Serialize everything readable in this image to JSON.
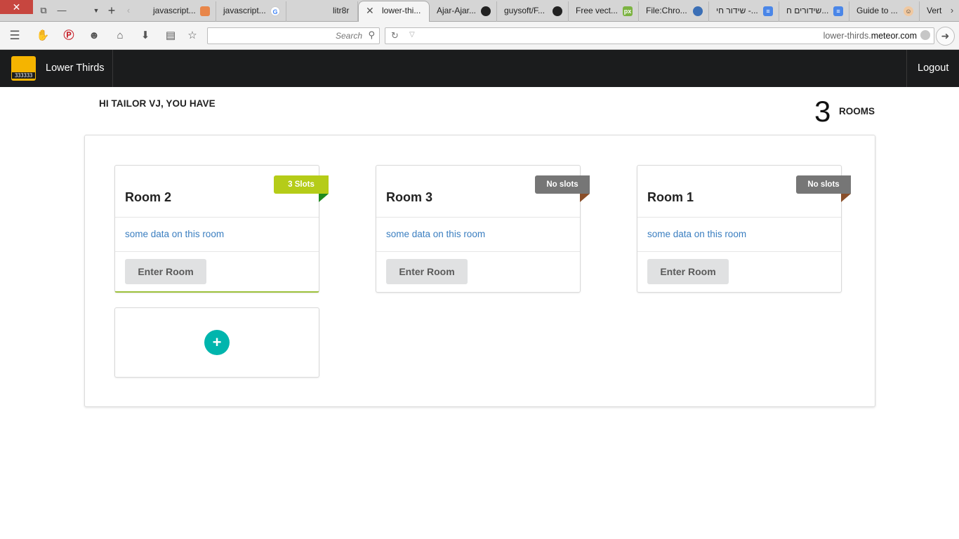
{
  "browser": {
    "tabs": [
      {
        "label": "javascript..."
      },
      {
        "label": "javascript..."
      },
      {
        "label": "litr8r"
      },
      {
        "label": "lower-thi..."
      },
      {
        "label": "Ajar-Ajar..."
      },
      {
        "label": "guysoft/F..."
      },
      {
        "label": "Free vect..."
      },
      {
        "label": "File:Chro..."
      },
      {
        "label": "שידור חי -..."
      },
      {
        "label": "שידורים ח..."
      },
      {
        "label": "Guide to ..."
      },
      {
        "label": "Vert"
      }
    ],
    "search_placeholder": "Search",
    "url_prefix": "lower-thirds.",
    "url_domain": "meteor.com"
  },
  "app": {
    "logo_text": "333333",
    "title": "Lower Thirds",
    "logout_label": "Logout",
    "greeting": "HI TAILOR VJ, YOU HAVE",
    "room_count": "3",
    "room_count_label": "ROOMS",
    "rooms": [
      {
        "name": "Room 2",
        "slots": "3 Slots",
        "description": "some data on this room",
        "button": "Enter Room"
      },
      {
        "name": "Room 3",
        "slots": "No slots",
        "description": "some data on this room",
        "button": "Enter Room"
      },
      {
        "name": "Room 1",
        "slots": "No slots",
        "description": "some data on this room",
        "button": "Enter Room"
      }
    ],
    "add_button_label": "+"
  },
  "colors": {
    "header_bg": "#1b1c1d",
    "logo_bg": "#f5b400",
    "ribbon_green": "#b5cc18",
    "ribbon_grey": "#767676",
    "link_blue": "#3a7ec0",
    "add_teal": "#00b5ad"
  }
}
